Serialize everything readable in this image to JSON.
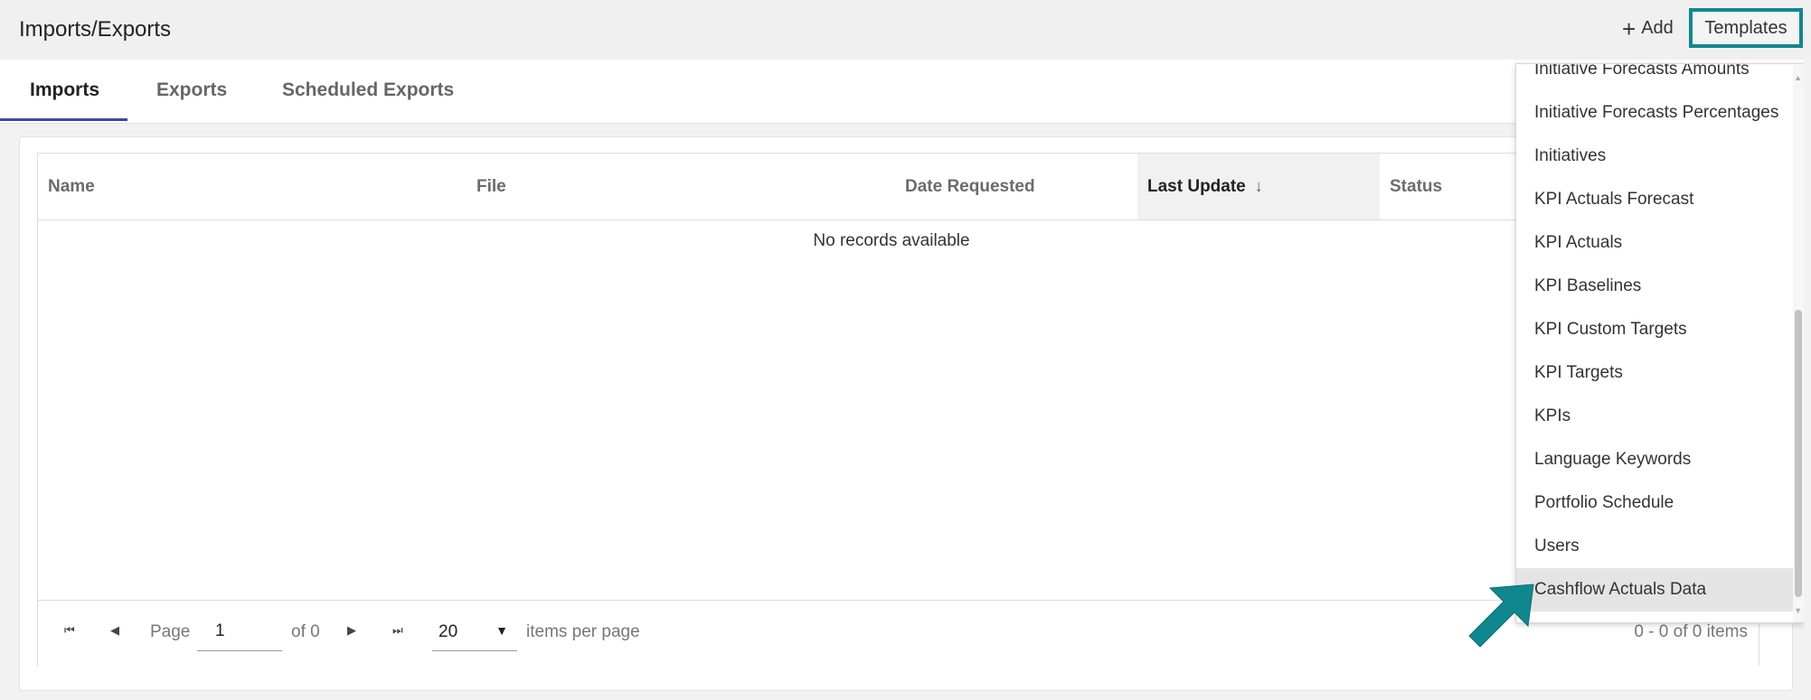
{
  "header": {
    "title": "Imports/Exports",
    "add_label": "Add",
    "templates_label": "Templates"
  },
  "tabs": [
    {
      "label": "Imports",
      "active": true
    },
    {
      "label": "Exports",
      "active": false
    },
    {
      "label": "Scheduled Exports",
      "active": false
    }
  ],
  "grid": {
    "columns": [
      "Name",
      "File",
      "Date Requested",
      "Last Update",
      "Status"
    ],
    "sorted_column": "Last Update",
    "sort_direction": "descending",
    "empty_message": "No records available"
  },
  "pager": {
    "page_label": "Page",
    "current_page": "1",
    "of_label": "of 0",
    "page_size": "20",
    "items_per_page_label": "items per page",
    "info": "0 - 0 of 0 items"
  },
  "templates_menu": {
    "partial_top_item": "Initiative Forecasts Amounts",
    "items": [
      "Initiative Forecasts Percentages",
      "Initiatives",
      "KPI Actuals Forecast",
      "KPI Actuals",
      "KPI Baselines",
      "KPI Custom Targets",
      "KPI Targets",
      "KPIs",
      "Language Keywords",
      "Portfolio Schedule",
      "Users",
      "Cashflow Actuals Data"
    ],
    "highlighted_item": "Cashflow Actuals Data"
  },
  "colors": {
    "accent_teal": "#10878f",
    "tab_indicator": "#3f47a8",
    "hover_gray": "#e4e4e4"
  }
}
